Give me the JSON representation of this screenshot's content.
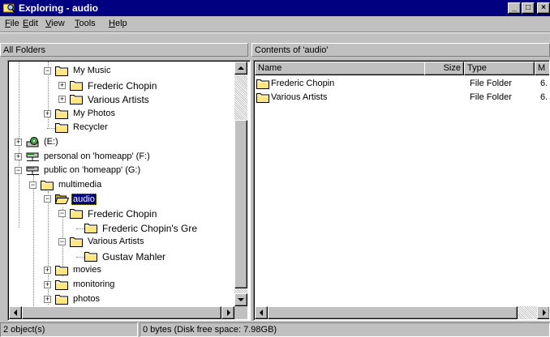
{
  "window": {
    "title": "Exploring - audio",
    "min_glyph": "_",
    "max_glyph": "□",
    "close_glyph": "×"
  },
  "menu": [
    "File",
    "Edit",
    "View",
    "Tools",
    "Help"
  ],
  "left_header": "All Folders",
  "right_header": "Contents of 'audio'",
  "tree": [
    {
      "label": "My Music",
      "expander": "-"
    },
    {
      "label": "Frederic Chopin",
      "expander": "+"
    },
    {
      "label": "Various Artists",
      "expander": "+"
    },
    {
      "label": "My Photos",
      "expander": "+"
    },
    {
      "label": "Recycler",
      "expander": ""
    },
    {
      "label": "(E:)",
      "expander": "+"
    },
    {
      "label": "personal on 'homeapp' (F:)",
      "expander": "+"
    },
    {
      "label": "public on 'homeapp' (G:)",
      "expander": "-"
    },
    {
      "label": "multimedia",
      "expander": "-"
    },
    {
      "label": "audio",
      "expander": "-"
    },
    {
      "label": "Frederic Chopin",
      "expander": "-"
    },
    {
      "label": "Frederic Chopin's Gre",
      "expander": ""
    },
    {
      "label": "Various Artists",
      "expander": "-"
    },
    {
      "label": "Gustav Mahler",
      "expander": ""
    },
    {
      "label": "movies",
      "expander": "+"
    },
    {
      "label": "monitoring",
      "expander": "+"
    },
    {
      "label": "photos",
      "expander": "+"
    }
  ],
  "columns": [
    "Name",
    "Size",
    "Type",
    "M"
  ],
  "files": [
    {
      "name": "Frederic Chopin",
      "size": "",
      "type": "File Folder",
      "modified": "6."
    },
    {
      "name": "Various Artists",
      "size": "",
      "type": "File Folder",
      "modified": "6."
    }
  ],
  "status": {
    "objects": "2 object(s)",
    "space": "0 bytes (Disk free space: 7.98GB)"
  },
  "colors": {
    "titlebar": "#000080",
    "face": "#c0c0c0",
    "folder": "#ffe680",
    "selection": "#000080"
  }
}
